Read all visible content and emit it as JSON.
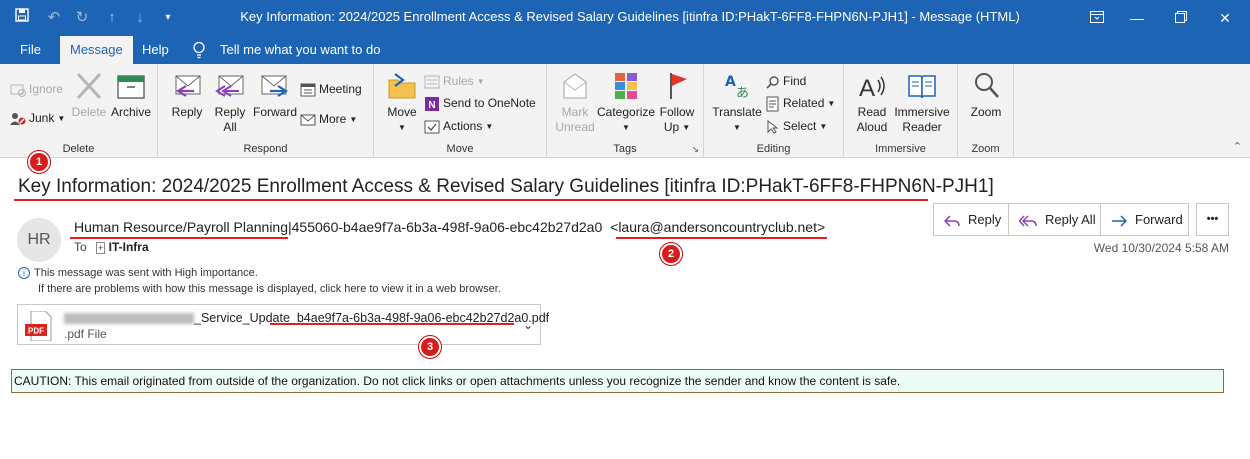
{
  "window": {
    "title": "Key Information: 2024/2025 Enrollment Access & Revised Salary Guidelines [itinfra ID:PHakT-6FF8-FHPN6N-PJH1]  -  Message (HTML)"
  },
  "menu": {
    "tabs": [
      {
        "label": "File"
      },
      {
        "label": "Message"
      },
      {
        "label": "Help"
      }
    ],
    "tell_me": "Tell me what you want to do"
  },
  "ribbon": {
    "delete_group": {
      "label": "Delete",
      "ignore": "Ignore",
      "junk": "Junk",
      "delete": "Delete",
      "archive": "Archive"
    },
    "respond_group": {
      "label": "Respond",
      "reply": "Reply",
      "reply_all_1": "Reply",
      "reply_all_2": "All",
      "forward": "Forward",
      "meeting": "Meeting",
      "more": "More"
    },
    "move_group": {
      "label": "Move",
      "move": "Move",
      "rules": "Rules",
      "onenote": "Send to OneNote",
      "actions": "Actions"
    },
    "tags_group": {
      "label": "Tags",
      "mark_unread_1": "Mark",
      "mark_unread_2": "Unread",
      "categorize": "Categorize",
      "follow_up_1": "Follow",
      "follow_up_2": "Up"
    },
    "editing_group": {
      "label": "Editing",
      "translate": "Translate",
      "find": "Find",
      "related": "Related",
      "select": "Select"
    },
    "immersive_group": {
      "label": "Immersive",
      "read_aloud_1": "Read",
      "read_aloud_2": "Aloud",
      "immersive_reader_1": "Immersive",
      "immersive_reader_2": "Reader"
    },
    "zoom_group": {
      "label": "Zoom",
      "zoom": "Zoom"
    }
  },
  "message": {
    "subject": "Key Information: 2024/2025 Enrollment Access & Revised Salary Guidelines [itinfra ID:PHakT-6FF8-FHPN6N-PJH1]",
    "avatar_initials": "HR",
    "sender_name": "Human Resource/Payroll Planning",
    "sender_suffix": "|455060-b4ae9f7a-6b3a-498f-9a06-ebc42b27d2a0",
    "sender_email": "<laura@andersoncountryclub.net>",
    "to_label": "To",
    "to_recipient": "IT-Infra",
    "date": "Wed 10/30/2024 5:58 AM",
    "info_importance": "This message was sent with High importance.",
    "info_display": "If there are problems with how this message is displayed, click here to view it in a web browser.",
    "actions": {
      "reply": "Reply",
      "reply_all": "Reply All",
      "forward": "Forward",
      "more": "•••"
    },
    "attachment": {
      "name_visible": "_Service_Update_b4ae9f7a-6b3a-498f-9a06-ebc42b27d2a0.pdf",
      "type": ".pdf File",
      "icon_text": "PDF"
    },
    "caution": "CAUTION: This email originated from outside of the organization. Do not click links or open attachments unless you recognize the sender and know the content is safe."
  },
  "annotations": [
    {
      "number": "1"
    },
    {
      "number": "2"
    },
    {
      "number": "3"
    }
  ],
  "colors": {
    "title_bar": "#1e64b4",
    "annotation_red": "#e02020",
    "caution_bg": "#eefcf8"
  }
}
